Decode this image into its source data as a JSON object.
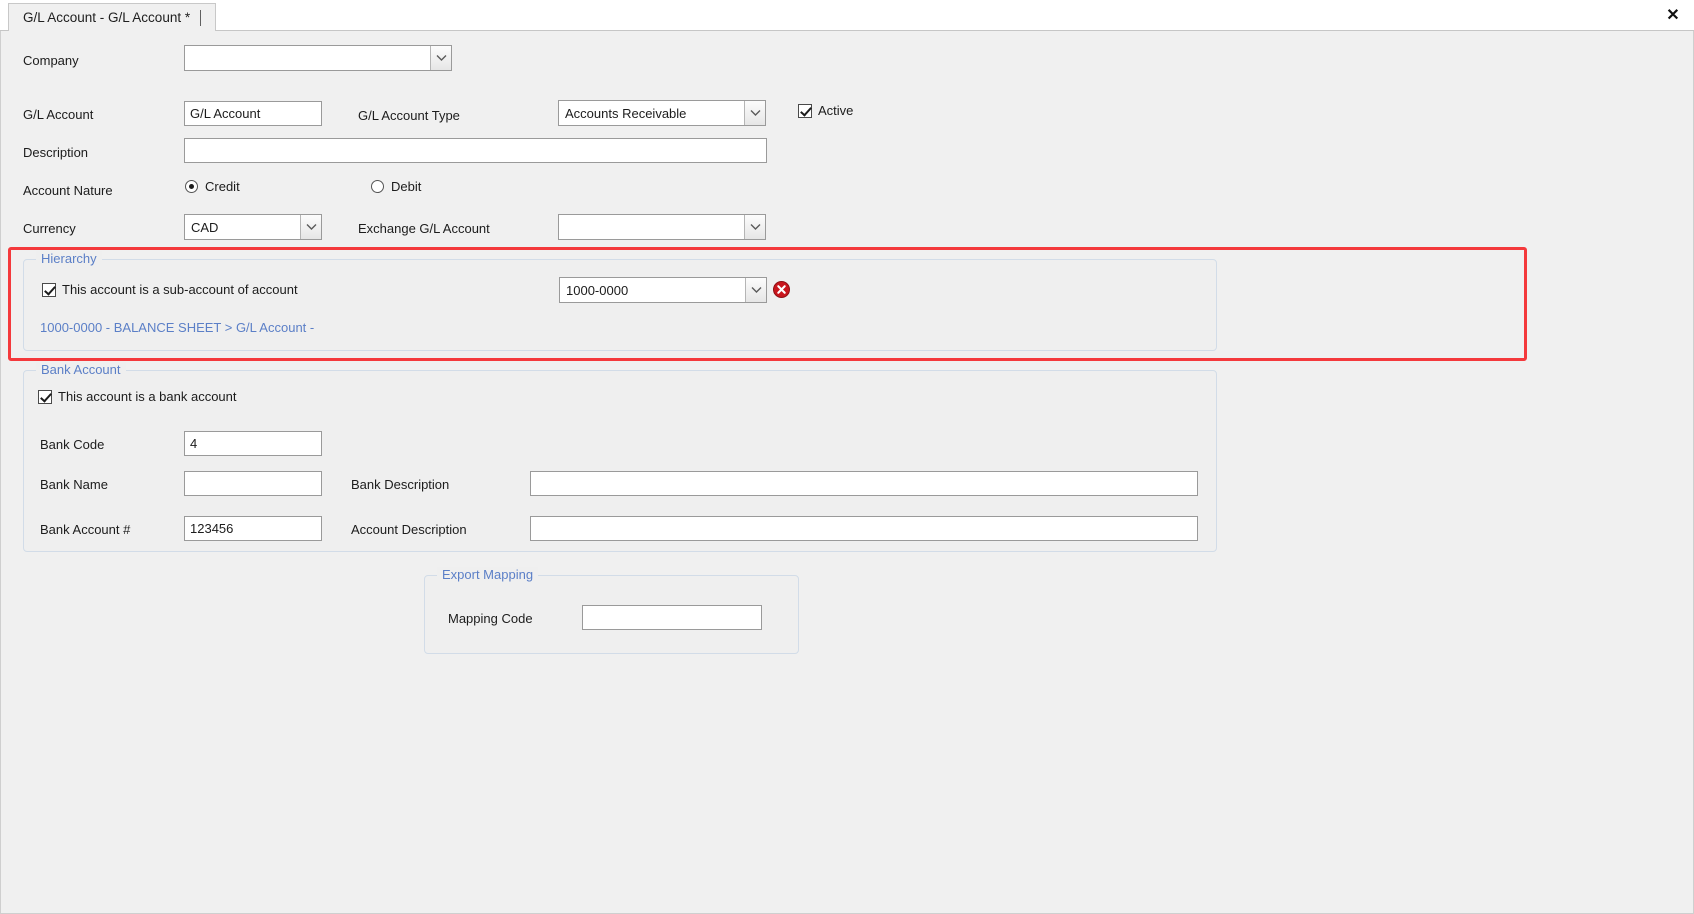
{
  "window": {
    "tab_title": "G/L Account - G/L Account *",
    "close_label": "✕"
  },
  "form": {
    "company": {
      "label": "Company",
      "value": "",
      "placeholder": ""
    },
    "gl_account": {
      "label": "G/L Account",
      "value": "G/L Account",
      "placeholder": ""
    },
    "gl_account_type": {
      "label": "G/L Account Type",
      "value": "Accounts Receivable"
    },
    "active": {
      "label": "Active",
      "checked": true
    },
    "description": {
      "label": "Description",
      "value": "",
      "placeholder": ""
    },
    "account_nature": {
      "label": "Account Nature",
      "options": [
        "Credit",
        "Debit"
      ],
      "selected": "Credit"
    },
    "currency": {
      "label": "Currency",
      "value": "CAD"
    },
    "exchange_gl_account": {
      "label": "Exchange G/L Account",
      "value": ""
    }
  },
  "hierarchy": {
    "title": "Hierarchy",
    "sub_account_checkbox": {
      "label": "This account is a sub-account of account",
      "checked": true
    },
    "parent_account": {
      "value": "1000-0000"
    },
    "delete_icon": "delete-circle-icon",
    "breadcrumb": "1000-0000 - BALANCE SHEET > G/L Account -",
    "highlight_color": "#f4393c"
  },
  "bank_account": {
    "title": "Bank Account",
    "is_bank_checkbox": {
      "label": "This account is a bank account",
      "checked": true
    },
    "bank_code": {
      "label": "Bank Code",
      "value": "4"
    },
    "bank_name": {
      "label": "Bank Name",
      "value": ""
    },
    "bank_description": {
      "label": "Bank Description",
      "value": ""
    },
    "bank_account_number": {
      "label": "Bank Account #",
      "value": "123456"
    },
    "account_description": {
      "label": "Account Description",
      "value": ""
    }
  },
  "export_mapping": {
    "title": "Export Mapping",
    "mapping_code": {
      "label": "Mapping Code",
      "value": ""
    }
  },
  "colors": {
    "accent_link": "#5b7fc7",
    "highlight": "#f4393c",
    "form_bg": "#f0f0f0"
  }
}
